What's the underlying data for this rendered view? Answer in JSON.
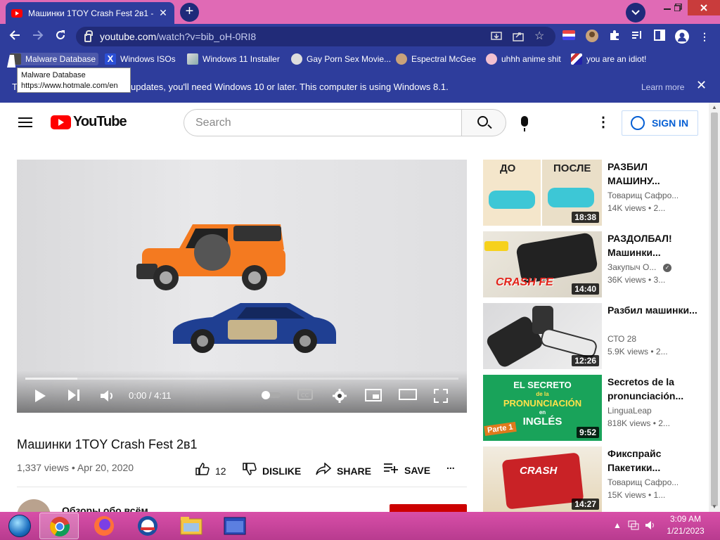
{
  "browser": {
    "tab_title": "Машинки 1TOY Crash Fest 2в1 - YouTube",
    "tab_close": "✕",
    "new_tab": "+",
    "url_host": "youtube.com",
    "url_path": "/watch?v=bib_oH-0RI8"
  },
  "bookmarks": [
    {
      "label": "Malware Database",
      "icon": "malware-icon",
      "color": "#4a4a4a"
    },
    {
      "label": "Windows ISOs",
      "icon": "x-icon",
      "color": "#2b4fd6"
    },
    {
      "label": "Windows 11 Installer",
      "icon": "installer-icon",
      "color": "#9aa"
    },
    {
      "label": "Gay Porn Sex Movie...",
      "icon": "skull-icon",
      "color": "#ddd"
    },
    {
      "label": "Espectral McGee",
      "icon": "avatar-icon",
      "color": "#c9a27a"
    },
    {
      "label": "uhhh anime shit",
      "icon": "anime-icon",
      "color": "#f2c0d0"
    },
    {
      "label": "you are an idiot!",
      "icon": "flag-icon",
      "color": "#c33"
    }
  ],
  "tooltip": {
    "title": "Malware Database",
    "url": "https://www.hotmale.com/en"
  },
  "infobar": {
    "text": "To get future Google Chrome updates, you'll need Windows 10 or later. This computer is using Windows 8.1.",
    "visible_text": "updates, you'll need Windows 10 or later. This computer is using Windows 8.1.",
    "prefix": "T",
    "learn_more": "Learn more",
    "close": "✕"
  },
  "youtube": {
    "logo_text": "YouTube",
    "search_placeholder": "Search",
    "sign_in": "SIGN IN"
  },
  "player": {
    "time": "0:00 / 4:11",
    "progress_fraction": 0.0,
    "buffered_fraction": 0.12
  },
  "video": {
    "title": "Машинки 1TOY Crash Fest 2в1",
    "info": "1,337 views • Apr 20, 2020",
    "likes": "12",
    "dislike": "DISLIKE",
    "share": "SHARE",
    "save": "SAVE",
    "more": "...",
    "channel": "Обзоры обо всём"
  },
  "recommendations": [
    {
      "title": "РАЗБИЛ МАШИНУ...",
      "channel": "Товарищ Сафро...",
      "views": "14K views • 2...",
      "duration": "18:38",
      "thumb_text_left": "ДО",
      "thumb_text_right": "ПОСЛЕ"
    },
    {
      "title": "РАЗДОЛБАЛ! Машинки...",
      "channel": "Закупыч О...",
      "views": "36K views • 3...",
      "duration": "14:40",
      "verified": true,
      "thumb_text": "CRASH FE"
    },
    {
      "title": "Разбил машинки...",
      "channel": "СТО 28",
      "views": "5.9K views • 2...",
      "duration": "12:26"
    },
    {
      "title": "Secretos de la pronunciación...",
      "channel": "LinguaLeap",
      "views": "818K views • 2...",
      "duration": "9:52",
      "thumb_lines": [
        "EL SECRETO",
        "de la",
        "PRONUNCIACIÓN",
        "en",
        "INGLÉS"
      ],
      "thumb_tag": "Parte 1"
    },
    {
      "title": "Фикспрайс Пакетики...",
      "channel": "Товарищ Сафро...",
      "views": "15K views • 1...",
      "duration": "14:27",
      "thumb_text": "CRASH"
    }
  ],
  "taskbar": {
    "time": "3:09 AM",
    "date": "1/21/2023"
  },
  "colors": {
    "browser_frame": "#2e3d9c",
    "tabstrip": "#e06ab5",
    "taskbar": "#c545a0",
    "youtube_red": "#ff0000",
    "link_blue": "#065fd4"
  }
}
